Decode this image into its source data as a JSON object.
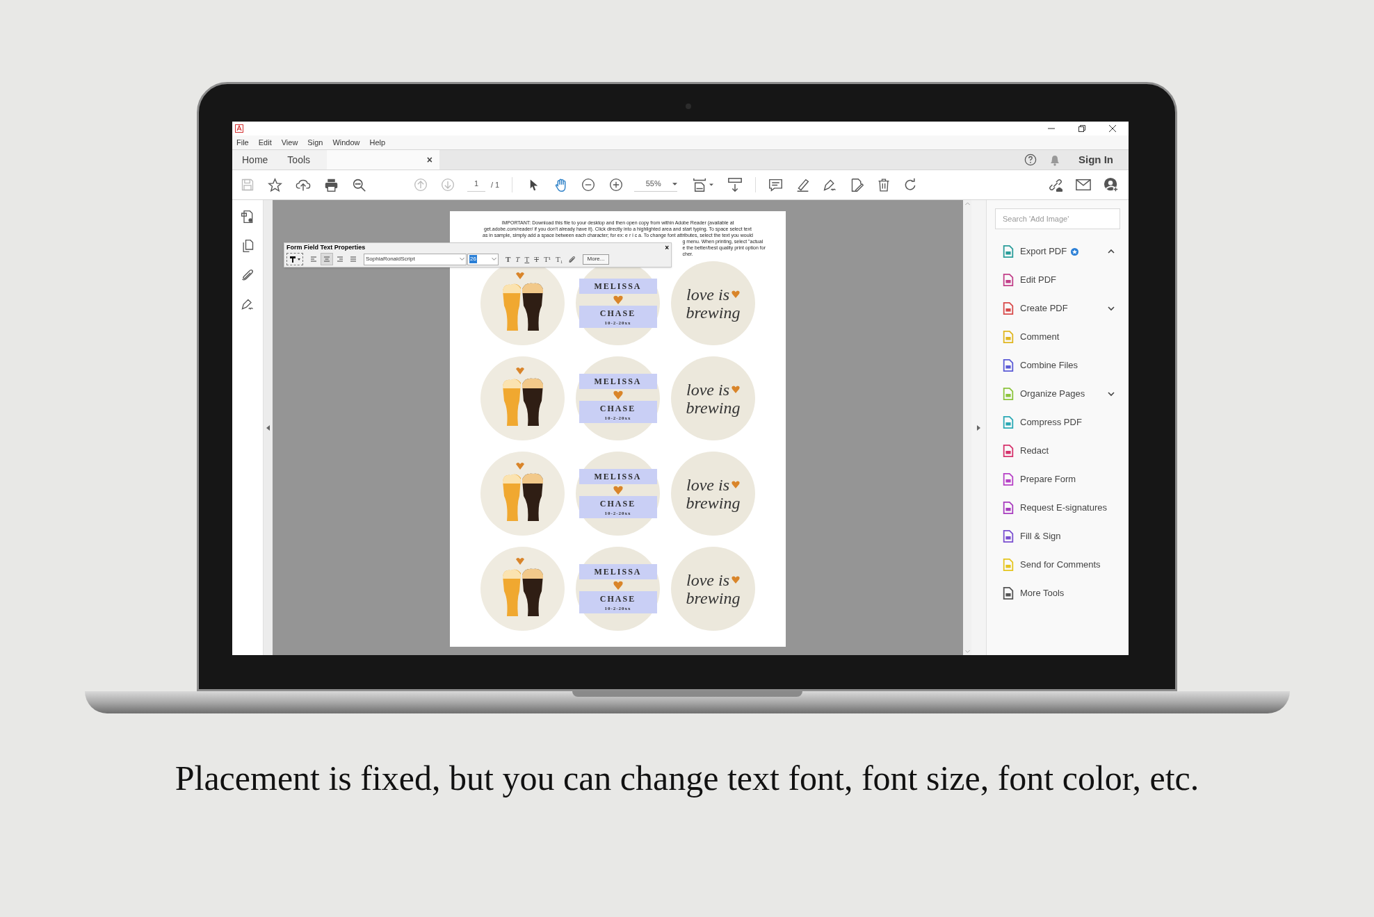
{
  "window": {
    "menu": [
      "File",
      "Edit",
      "View",
      "Sign",
      "Window",
      "Help"
    ]
  },
  "tabs": [
    {
      "label": "Home"
    },
    {
      "label": "Tools"
    }
  ],
  "document_tab": {
    "close": "×"
  },
  "header": {
    "sign_in": "Sign In"
  },
  "toolbar": {
    "page": "1",
    "page_count": "/ 1",
    "zoom": "55%"
  },
  "document": {
    "notice_lines": [
      "IMPORTANT: Download this file to your desktop and then open copy from within Adobe Reader (available at",
      "get.adobe.com/reader/ if you don't already have it). Click directly into a highlighted area and start typing. To space select text",
      "as in sample, simply add a space between each character; for ex: e r i c a. To change font attributes, select the text you would"
    ],
    "notice_fragments": [
      "g menu. When printing, select \"actual",
      "e the better/best quality print option for",
      "cher."
    ],
    "label_rows": [
      [
        {
          "kind": "beer"
        },
        {
          "kind": "names",
          "first": "MELISSA",
          "second": "CHASE",
          "date": "10-2-20xx"
        },
        {
          "kind": "script",
          "line1": "love is",
          "line2": "brewing"
        }
      ],
      [
        {
          "kind": "beer"
        },
        {
          "kind": "names",
          "first": "MELISSA",
          "second": "CHASE",
          "date": "10-2-20xx"
        },
        {
          "kind": "script",
          "line1": "love is",
          "line2": "brewing"
        }
      ],
      [
        {
          "kind": "beer"
        },
        {
          "kind": "names",
          "first": "MELISSA",
          "second": "CHASE",
          "date": "10-2-20xx"
        },
        {
          "kind": "script",
          "line1": "love is",
          "line2": "brewing"
        }
      ],
      [
        {
          "kind": "beer"
        },
        {
          "kind": "names",
          "first": "MELISSA",
          "second": "CHASE",
          "date": "10-2-20xx"
        },
        {
          "kind": "script",
          "line1": "love is",
          "line2": "brewing"
        }
      ]
    ]
  },
  "text_properties": {
    "title": "Form Field Text Properties",
    "close": "×",
    "alignments": [
      {
        "selected": false
      },
      {
        "selected": true
      },
      {
        "selected": false
      },
      {
        "selected": false
      }
    ],
    "font": "SophiaRonaldScript",
    "size": "26",
    "formats": [
      {
        "kind": "bold",
        "glyph": "T"
      },
      {
        "kind": "italic",
        "glyph": "T"
      },
      {
        "kind": "underline",
        "glyph": "T"
      },
      {
        "kind": "strike",
        "glyph": "T"
      },
      {
        "kind": "super",
        "glyph": "T¹"
      },
      {
        "kind": "sub",
        "glyph": "T₁"
      }
    ],
    "more": "More..."
  },
  "tools_panel": {
    "search_placeholder": "Search 'Add Image'",
    "tools": [
      {
        "label": "Export PDF",
        "color": "#2a9d9a",
        "badge": true,
        "expanded": true
      },
      {
        "label": "Edit PDF",
        "color": "#c2418a"
      },
      {
        "label": "Create PDF",
        "color": "#d84a4a",
        "expanded": false
      },
      {
        "label": "Comment",
        "color": "#e0b620"
      },
      {
        "label": "Combine Files",
        "color": "#5b5bd6"
      },
      {
        "label": "Organize Pages",
        "color": "#8cc43c",
        "expanded": false
      },
      {
        "label": "Compress PDF",
        "color": "#2aa9b5"
      },
      {
        "label": "Redact",
        "color": "#d6336c"
      },
      {
        "label": "Prepare Form",
        "color": "#b640c6"
      },
      {
        "label": "Request E-signatures",
        "color": "#a83cbf"
      },
      {
        "label": "Fill & Sign",
        "color": "#7a4fd0"
      },
      {
        "label": "Send for Comments",
        "color": "#e5c51e"
      },
      {
        "label": "More Tools",
        "color": "#555555"
      }
    ]
  },
  "caption": "Placement is fixed, but you can change text font, font size, font color, etc."
}
